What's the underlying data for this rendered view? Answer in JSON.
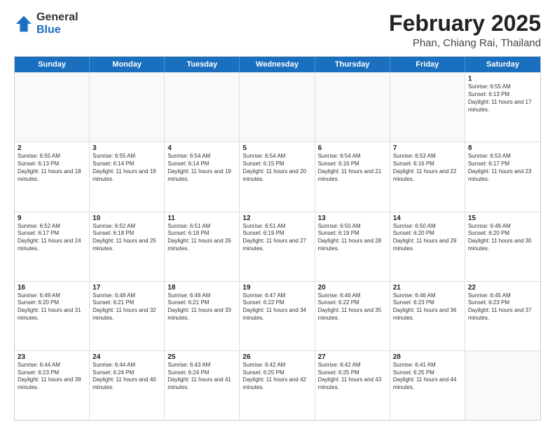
{
  "header": {
    "logo_general": "General",
    "logo_blue": "Blue",
    "month_title": "February 2025",
    "location": "Phan, Chiang Rai, Thailand"
  },
  "days_of_week": [
    "Sunday",
    "Monday",
    "Tuesday",
    "Wednesday",
    "Thursday",
    "Friday",
    "Saturday"
  ],
  "weeks": [
    [
      {
        "day": "",
        "info": "",
        "empty": true
      },
      {
        "day": "",
        "info": "",
        "empty": true
      },
      {
        "day": "",
        "info": "",
        "empty": true
      },
      {
        "day": "",
        "info": "",
        "empty": true
      },
      {
        "day": "",
        "info": "",
        "empty": true
      },
      {
        "day": "",
        "info": "",
        "empty": true
      },
      {
        "day": "1",
        "info": "Sunrise: 6:55 AM\nSunset: 6:13 PM\nDaylight: 11 hours and 17 minutes.",
        "empty": false
      }
    ],
    [
      {
        "day": "2",
        "info": "Sunrise: 6:55 AM\nSunset: 6:13 PM\nDaylight: 11 hours and 18 minutes.",
        "empty": false
      },
      {
        "day": "3",
        "info": "Sunrise: 6:55 AM\nSunset: 6:14 PM\nDaylight: 11 hours and 19 minutes.",
        "empty": false
      },
      {
        "day": "4",
        "info": "Sunrise: 6:54 AM\nSunset: 6:14 PM\nDaylight: 11 hours and 19 minutes.",
        "empty": false
      },
      {
        "day": "5",
        "info": "Sunrise: 6:54 AM\nSunset: 6:15 PM\nDaylight: 11 hours and 20 minutes.",
        "empty": false
      },
      {
        "day": "6",
        "info": "Sunrise: 6:54 AM\nSunset: 6:16 PM\nDaylight: 11 hours and 21 minutes.",
        "empty": false
      },
      {
        "day": "7",
        "info": "Sunrise: 6:53 AM\nSunset: 6:16 PM\nDaylight: 11 hours and 22 minutes.",
        "empty": false
      },
      {
        "day": "8",
        "info": "Sunrise: 6:53 AM\nSunset: 6:17 PM\nDaylight: 11 hours and 23 minutes.",
        "empty": false
      }
    ],
    [
      {
        "day": "9",
        "info": "Sunrise: 6:52 AM\nSunset: 6:17 PM\nDaylight: 11 hours and 24 minutes.",
        "empty": false
      },
      {
        "day": "10",
        "info": "Sunrise: 6:52 AM\nSunset: 6:18 PM\nDaylight: 11 hours and 25 minutes.",
        "empty": false
      },
      {
        "day": "11",
        "info": "Sunrise: 6:51 AM\nSunset: 6:18 PM\nDaylight: 11 hours and 26 minutes.",
        "empty": false
      },
      {
        "day": "12",
        "info": "Sunrise: 6:51 AM\nSunset: 6:19 PM\nDaylight: 11 hours and 27 minutes.",
        "empty": false
      },
      {
        "day": "13",
        "info": "Sunrise: 6:50 AM\nSunset: 6:19 PM\nDaylight: 11 hours and 28 minutes.",
        "empty": false
      },
      {
        "day": "14",
        "info": "Sunrise: 6:50 AM\nSunset: 6:20 PM\nDaylight: 11 hours and 29 minutes.",
        "empty": false
      },
      {
        "day": "15",
        "info": "Sunrise: 6:49 AM\nSunset: 6:20 PM\nDaylight: 11 hours and 30 minutes.",
        "empty": false
      }
    ],
    [
      {
        "day": "16",
        "info": "Sunrise: 6:49 AM\nSunset: 6:20 PM\nDaylight: 11 hours and 31 minutes.",
        "empty": false
      },
      {
        "day": "17",
        "info": "Sunrise: 6:48 AM\nSunset: 6:21 PM\nDaylight: 11 hours and 32 minutes.",
        "empty": false
      },
      {
        "day": "18",
        "info": "Sunrise: 6:48 AM\nSunset: 6:21 PM\nDaylight: 11 hours and 33 minutes.",
        "empty": false
      },
      {
        "day": "19",
        "info": "Sunrise: 6:47 AM\nSunset: 6:22 PM\nDaylight: 11 hours and 34 minutes.",
        "empty": false
      },
      {
        "day": "20",
        "info": "Sunrise: 6:46 AM\nSunset: 6:22 PM\nDaylight: 11 hours and 35 minutes.",
        "empty": false
      },
      {
        "day": "21",
        "info": "Sunrise: 6:46 AM\nSunset: 6:23 PM\nDaylight: 11 hours and 36 minutes.",
        "empty": false
      },
      {
        "day": "22",
        "info": "Sunrise: 6:45 AM\nSunset: 6:23 PM\nDaylight: 11 hours and 37 minutes.",
        "empty": false
      }
    ],
    [
      {
        "day": "23",
        "info": "Sunrise: 6:44 AM\nSunset: 6:23 PM\nDaylight: 11 hours and 39 minutes.",
        "empty": false
      },
      {
        "day": "24",
        "info": "Sunrise: 6:44 AM\nSunset: 6:24 PM\nDaylight: 11 hours and 40 minutes.",
        "empty": false
      },
      {
        "day": "25",
        "info": "Sunrise: 6:43 AM\nSunset: 6:24 PM\nDaylight: 11 hours and 41 minutes.",
        "empty": false
      },
      {
        "day": "26",
        "info": "Sunrise: 6:42 AM\nSunset: 6:25 PM\nDaylight: 11 hours and 42 minutes.",
        "empty": false
      },
      {
        "day": "27",
        "info": "Sunrise: 6:42 AM\nSunset: 6:25 PM\nDaylight: 11 hours and 43 minutes.",
        "empty": false
      },
      {
        "day": "28",
        "info": "Sunrise: 6:41 AM\nSunset: 6:25 PM\nDaylight: 11 hours and 44 minutes.",
        "empty": false
      },
      {
        "day": "",
        "info": "",
        "empty": true
      }
    ]
  ]
}
